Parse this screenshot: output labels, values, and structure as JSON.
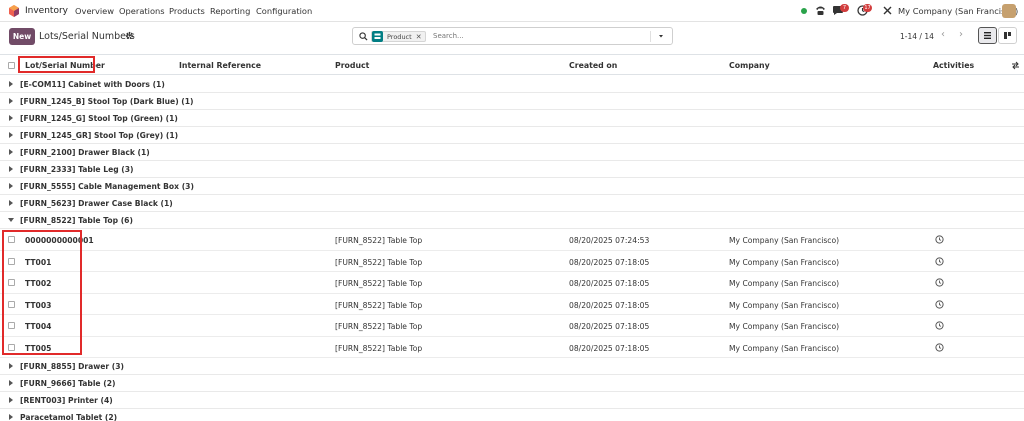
{
  "topnav": {
    "app_name": "Inventory",
    "menu": [
      "Overview",
      "Operations",
      "Products",
      "Reporting",
      "Configuration"
    ],
    "badges": {
      "messages": "7",
      "activities": "17"
    },
    "company": "My Company (San Francisco)"
  },
  "control": {
    "new_label": "New",
    "breadcrumb": "Lots/Serial Numbers",
    "facet_label": "Product",
    "search_placeholder": "Search...",
    "pager": "1-14 / 14"
  },
  "columns": {
    "lot": "Lot/Serial Number",
    "ref": "Internal Reference",
    "product": "Product",
    "created": "Created on",
    "company": "Company",
    "activities": "Activities"
  },
  "groups_before": [
    "[E-COM11] Cabinet with Doors (1)",
    "[FURN_1245_B] Stool Top (Dark Blue) (1)",
    "[FURN_1245_G] Stool Top (Green) (1)",
    "[FURN_1245_GR] Stool Top (Grey) (1)",
    "[FURN_2100] Drawer Black (1)",
    "[FURN_2333] Table Leg (3)",
    "[FURN_5555] Cable Management Box (3)",
    "[FURN_5623] Drawer Case Black (1)"
  ],
  "open_group": "[FURN_8522] Table Top (6)",
  "rows": [
    {
      "lot": "0000000000001",
      "product": "[FURN_8522] Table Top",
      "created": "08/20/2025 07:24:53",
      "company": "My Company (San Francisco)"
    },
    {
      "lot": "TT001",
      "product": "[FURN_8522] Table Top",
      "created": "08/20/2025 07:18:05",
      "company": "My Company (San Francisco)"
    },
    {
      "lot": "TT002",
      "product": "[FURN_8522] Table Top",
      "created": "08/20/2025 07:18:05",
      "company": "My Company (San Francisco)"
    },
    {
      "lot": "TT003",
      "product": "[FURN_8522] Table Top",
      "created": "08/20/2025 07:18:05",
      "company": "My Company (San Francisco)"
    },
    {
      "lot": "TT004",
      "product": "[FURN_8522] Table Top",
      "created": "08/20/2025 07:18:05",
      "company": "My Company (San Francisco)"
    },
    {
      "lot": "TT005",
      "product": "[FURN_8522] Table Top",
      "created": "08/20/2025 07:18:05",
      "company": "My Company (San Francisco)"
    }
  ],
  "groups_after": [
    "[FURN_8855] Drawer (3)",
    "[FURN_9666] Table (2)",
    "[RENT003] Printer (4)",
    "Paracetamol Tablet (2)"
  ],
  "colors": {
    "brand": "#714b67",
    "highlight": "#e12a2a"
  }
}
